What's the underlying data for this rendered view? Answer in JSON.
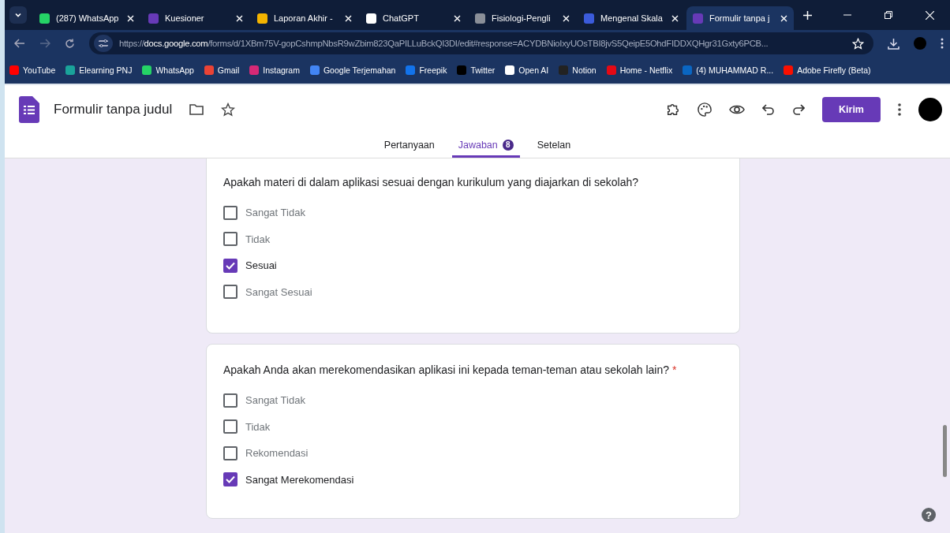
{
  "browser": {
    "tabs": [
      {
        "title": "(287) WhatsApp",
        "selected": false,
        "color": "#25d366"
      },
      {
        "title": "Kuesioner",
        "selected": false,
        "color": "#673ab7"
      },
      {
        "title": "Laporan Akhir -",
        "selected": false,
        "color": "#f4b400"
      },
      {
        "title": "ChatGPT",
        "selected": false,
        "color": "#ffffff"
      },
      {
        "title": "Fisiologi-Pengli",
        "selected": false,
        "color": "#8a8f98"
      },
      {
        "title": "Mengenal Skala",
        "selected": false,
        "color": "#3b5bdb"
      },
      {
        "title": "Formulir tanpa j",
        "selected": true,
        "color": "#673ab7"
      }
    ],
    "url": {
      "scheme": "https://",
      "host": "docs.google.com",
      "path": "/forms/d/1XBm75V-gopCshmpNbsR9wZbim823QaPILLuBckQI3DI/edit#response=ACYDBNioIxyUOsTBI8jvS5QeipE5OhdFIDDXQHgr31Gxty6PCB..."
    },
    "bookmarks": [
      {
        "label": "YouTube",
        "color": "#ff0000"
      },
      {
        "label": "Elearning PNJ",
        "color": "#1aa39a"
      },
      {
        "label": "WhatsApp",
        "color": "#25d366"
      },
      {
        "label": "Gmail",
        "color": "#ea4335"
      },
      {
        "label": "Instagram",
        "color": "#d62976"
      },
      {
        "label": "Google Terjemahan",
        "color": "#4285f4"
      },
      {
        "label": "Freepik",
        "color": "#1273eb"
      },
      {
        "label": "Twitter",
        "color": "#000000"
      },
      {
        "label": "Open AI",
        "color": "#ffffff"
      },
      {
        "label": "Notion",
        "color": "#222222"
      },
      {
        "label": "Home - Netflix",
        "color": "#e50914"
      },
      {
        "label": "(4) MUHAMMAD R...",
        "color": "#0a66c2"
      },
      {
        "label": "Adobe Firefly (Beta)",
        "color": "#fa0f00"
      }
    ]
  },
  "form": {
    "title": "Formulir tanpa judul",
    "send_button": "Kirim",
    "tabs": [
      {
        "label": "Pertanyaan",
        "selected": false
      },
      {
        "label": "Jawaban",
        "selected": true,
        "badge": "8"
      },
      {
        "label": "Setelan",
        "selected": false
      }
    ],
    "questions": [
      {
        "text": "Apakah materi di dalam aplikasi sesuai dengan kurikulum yang diajarkan di sekolah?",
        "options": [
          {
            "label": "Sangat Tidak",
            "checked": false
          },
          {
            "label": "Tidak",
            "checked": false
          },
          {
            "label": "Sesuai",
            "checked": true
          },
          {
            "label": "Sangat Sesuai",
            "checked": false
          }
        ]
      },
      {
        "text": "Apakah Anda akan merekomendasikan aplikasi ini kepada teman-teman atau sekolah lain?",
        "required_mark": "*",
        "options": [
          {
            "label": "Sangat Tidak",
            "checked": false
          },
          {
            "label": "Tidak",
            "checked": false
          },
          {
            "label": "Rekomendasi",
            "checked": false
          },
          {
            "label": "Sangat Merekomendasi",
            "checked": true
          }
        ]
      }
    ],
    "help": "?"
  }
}
